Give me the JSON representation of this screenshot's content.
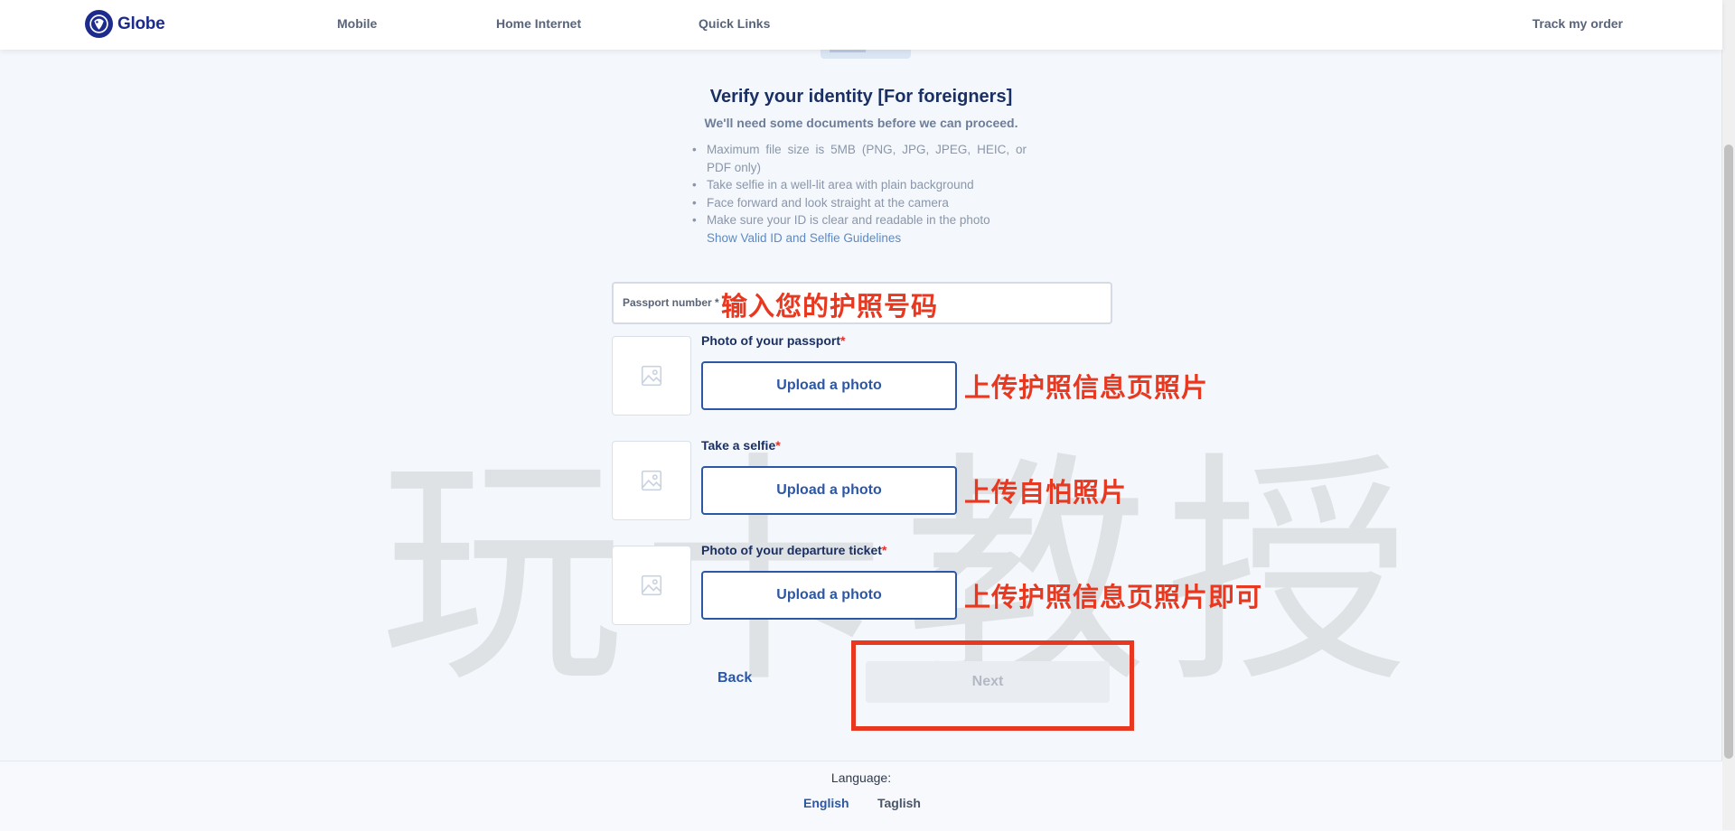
{
  "header": {
    "brand": "Globe",
    "nav": [
      "Mobile",
      "Home Internet",
      "Quick Links"
    ],
    "track_order": "Track my order"
  },
  "page": {
    "title": "Verify your identity [For foreigners]",
    "subtitle": "We'll need some documents before we can proceed.",
    "rules": [
      "Maximum file size is 5MB (PNG, JPG, JPEG, HEIC, or PDF only)",
      "Take selfie in a well-lit area with plain background",
      "Face forward and look straight at the camera",
      "Make sure your ID is clear and readable in the photo"
    ],
    "guidelines_link": "Show Valid ID and Selfie Guidelines"
  },
  "form": {
    "passport_label": "Passport number *",
    "passport_value": "",
    "uploads": [
      {
        "label": "Photo of your passport",
        "button": "Upload a photo"
      },
      {
        "label": "Take a selfie",
        "button": "Upload a photo"
      },
      {
        "label": "Photo of your departure ticket",
        "button": "Upload a photo"
      }
    ],
    "required_mark": "*",
    "back": "Back",
    "next": "Next"
  },
  "annotations": {
    "passport": "输入您的护照号码",
    "upload_passport": "上传护照信息页照片",
    "upload_selfie": "上传自怕照片",
    "upload_ticket": "上传护照信息页照片即可",
    "watermark": "玩卡教授"
  },
  "footer": {
    "language_label": "Language:",
    "languages": [
      "English",
      "Taglish"
    ]
  },
  "colors": {
    "brand": "#1d2c8c",
    "primary": "#2c57a5",
    "annotation": "#e8381f",
    "background": "#f4f8fc"
  }
}
